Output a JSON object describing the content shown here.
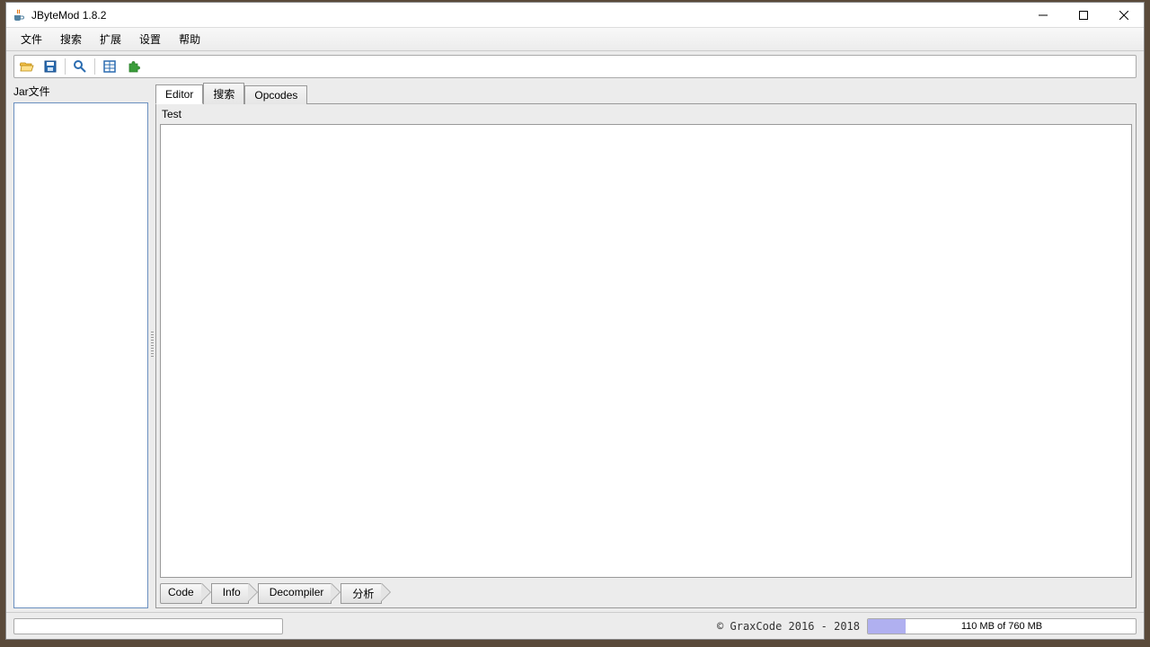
{
  "window": {
    "title": "JByteMod 1.8.2"
  },
  "menu": {
    "file": "文件",
    "search": "搜索",
    "ext": "扩展",
    "settings": "设置",
    "help": "帮助"
  },
  "sidebar": {
    "label": "Jar文件"
  },
  "tabs": {
    "editor": "Editor",
    "search": "搜索",
    "opcodes": "Opcodes"
  },
  "content": {
    "label": "Test"
  },
  "breadcrumb": {
    "code": "Code",
    "info": "Info",
    "decompiler": "Decompiler",
    "analysis": "分析"
  },
  "status": {
    "copyright": "© GraxCode 2016 - 2018",
    "memory": "110 MB of 760 MB",
    "memory_percent": 14
  }
}
